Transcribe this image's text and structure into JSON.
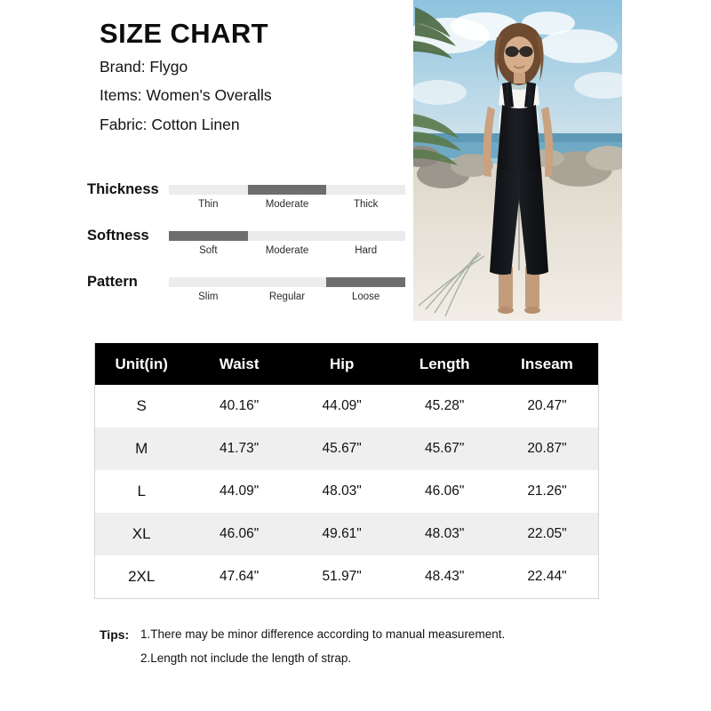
{
  "header": {
    "title": "SIZE CHART",
    "brand_line": "Brand: Flygo",
    "items_line": "Items: Women's Overalls",
    "fabric_line": "Fabric: Cotton Linen"
  },
  "attributes": [
    {
      "label": "Thickness",
      "ticks": [
        "Thin",
        "Moderate",
        "Thick"
      ],
      "selected_index": 1,
      "selected_value": "Moderate"
    },
    {
      "label": "Softness",
      "ticks": [
        "Soft",
        "Moderate",
        "Hard"
      ],
      "selected_index": 0,
      "selected_value": "Soft"
    },
    {
      "label": "Pattern",
      "ticks": [
        "Slim",
        "Regular",
        "Loose"
      ],
      "selected_index": 2,
      "selected_value": "Loose"
    }
  ],
  "table": {
    "headers": [
      "Unit(in)",
      "Waist",
      "Hip",
      "Length",
      "Inseam"
    ],
    "rows": [
      {
        "size": "S",
        "waist": "40.16\"",
        "hip": "44.09\"",
        "length": "45.28\"",
        "inseam": "20.47\""
      },
      {
        "size": "M",
        "waist": "41.73\"",
        "hip": "45.67\"",
        "length": "45.67\"",
        "inseam": "20.87\""
      },
      {
        "size": "L",
        "waist": "44.09\"",
        "hip": "48.03\"",
        "length": "46.06\"",
        "inseam": "21.26\""
      },
      {
        "size": "XL",
        "waist": "46.06\"",
        "hip": "49.61\"",
        "length": "48.03\"",
        "inseam": "22.05\""
      },
      {
        "size": "2XL",
        "waist": "47.64\"",
        "hip": "51.97\"",
        "length": "48.43\"",
        "inseam": "22.44\""
      }
    ]
  },
  "tips": {
    "label": "Tips:",
    "item1": "1.There may be minor difference according to manual measurement.",
    "item2": "2.Length not include the length of strap."
  },
  "photo": {
    "alt": "Woman wearing black cotton linen overalls on a tropical beach",
    "colors": {
      "sky": "#b9d8ea",
      "cloud": "#f2f6f8",
      "sea": "#6fa9c4",
      "sand": "#e8e2d8",
      "rock": "#9b978c",
      "palm": "#4d6b43",
      "garment": "#14161a",
      "top": "#f6f5f2",
      "skin": "#caa281",
      "hair": "#6d4a30"
    }
  },
  "theme": {
    "header_bg": "#000000",
    "alt_row_bg": "#efefef",
    "slider_track": "#ececec",
    "slider_fill": "#6e6e6e",
    "text": "#111111"
  }
}
